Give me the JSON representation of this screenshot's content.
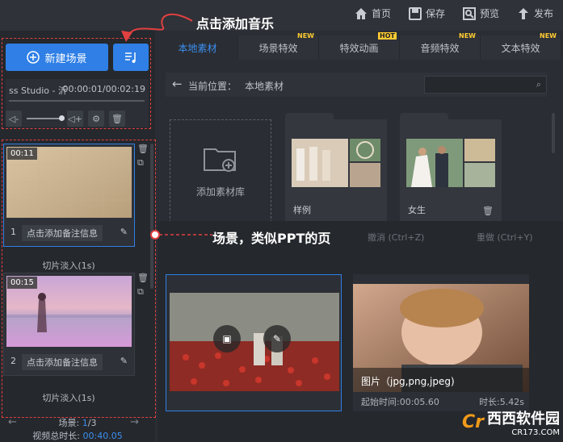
{
  "topbar": {
    "home": "首页",
    "save": "保存",
    "preview": "预览",
    "publish": "发布"
  },
  "left": {
    "new_scene": "新建场景",
    "music": {
      "title": "ss Studio - 沂",
      "time": "00:00:01/00:02:19"
    },
    "scenes": [
      {
        "duration": "00:11",
        "number": "1",
        "note": "点击添加备注信息",
        "transition": "切片淡入(1s)"
      },
      {
        "duration": "00:15",
        "number": "2",
        "note": "点击添加备注信息",
        "transition": "切片淡入(1s)"
      }
    ],
    "footer": {
      "scene_label": "场景:",
      "scene_current": "1",
      "scene_total": "/3",
      "total_label": "视频总时长:",
      "total_value": "00:40.05"
    }
  },
  "right": {
    "tabs": [
      {
        "label": "本地素材",
        "badge": ""
      },
      {
        "label": "场景特效",
        "badge": "NEW"
      },
      {
        "label": "特效动画",
        "badge": "HOT"
      },
      {
        "label": "音频特效",
        "badge": "NEW"
      },
      {
        "label": "文本特效",
        "badge": "NEW"
      }
    ],
    "path_label": "当前位置：",
    "path_value": "本地素材",
    "add_folder": "添加素材库",
    "folders": [
      "样例",
      "女生"
    ],
    "undo": "撤消 (Ctrl+Z)",
    "redo": "重做 (Ctrl+Y)",
    "clip2": {
      "type": "图片（jpg,png,jpeg)",
      "start": "起始时间:00:05.60",
      "duration": "时长:5.42s"
    }
  },
  "annotations": {
    "add_music": "点击添加音乐",
    "scene_hint": "场景，类似PPT的页"
  },
  "watermark": {
    "name": "西西软件园",
    "url": "CR173.COM"
  },
  "colors": {
    "accent": "#2f7fe6",
    "annotation": "#e04040"
  }
}
